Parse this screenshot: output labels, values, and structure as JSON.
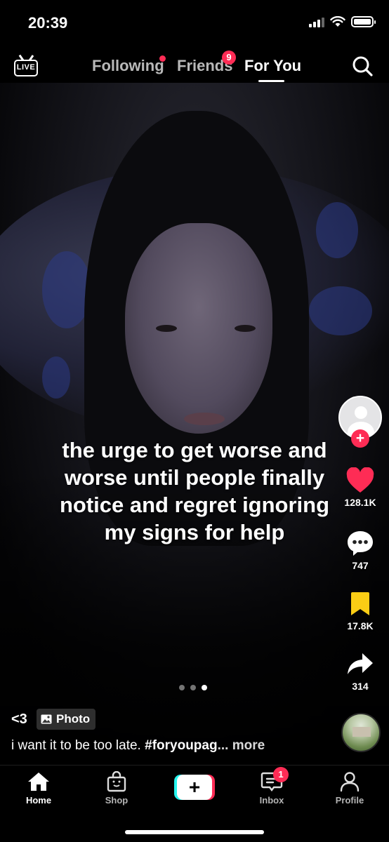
{
  "status_bar": {
    "time": "20:39"
  },
  "top_nav": {
    "live_label": "LIVE",
    "tabs": [
      {
        "label": "Following",
        "active": false
      },
      {
        "label": "Friends",
        "active": false,
        "badge": "9"
      },
      {
        "label": "For You",
        "active": true
      }
    ],
    "icons": [
      "live-icon",
      "search-icon"
    ]
  },
  "post": {
    "overlay_text": "the urge to get worse and worse until people finally notice and regret ignoring my signs for help",
    "author": "<3",
    "media_tag": "Photo",
    "description": "i want it to be too late. ",
    "hashtag": "#foryoupag",
    "more_label": "... more",
    "carousel": {
      "count": 3,
      "active_index": 2
    }
  },
  "actions": {
    "likes": "128.1K",
    "comments": "747",
    "saves": "17.8K",
    "shares": "314"
  },
  "bottom_bar": {
    "items": [
      {
        "label": "Home",
        "active": true
      },
      {
        "label": "Shop",
        "active": false
      },
      {
        "label": "",
        "active": false
      },
      {
        "label": "Inbox",
        "active": false,
        "badge": "1"
      },
      {
        "label": "Profile",
        "active": false
      }
    ]
  },
  "colors": {
    "accent_red": "#fe2c55",
    "accent_cyan": "#25f4ee",
    "like_red": "#fe2c55",
    "save_yellow": "#facd15"
  }
}
